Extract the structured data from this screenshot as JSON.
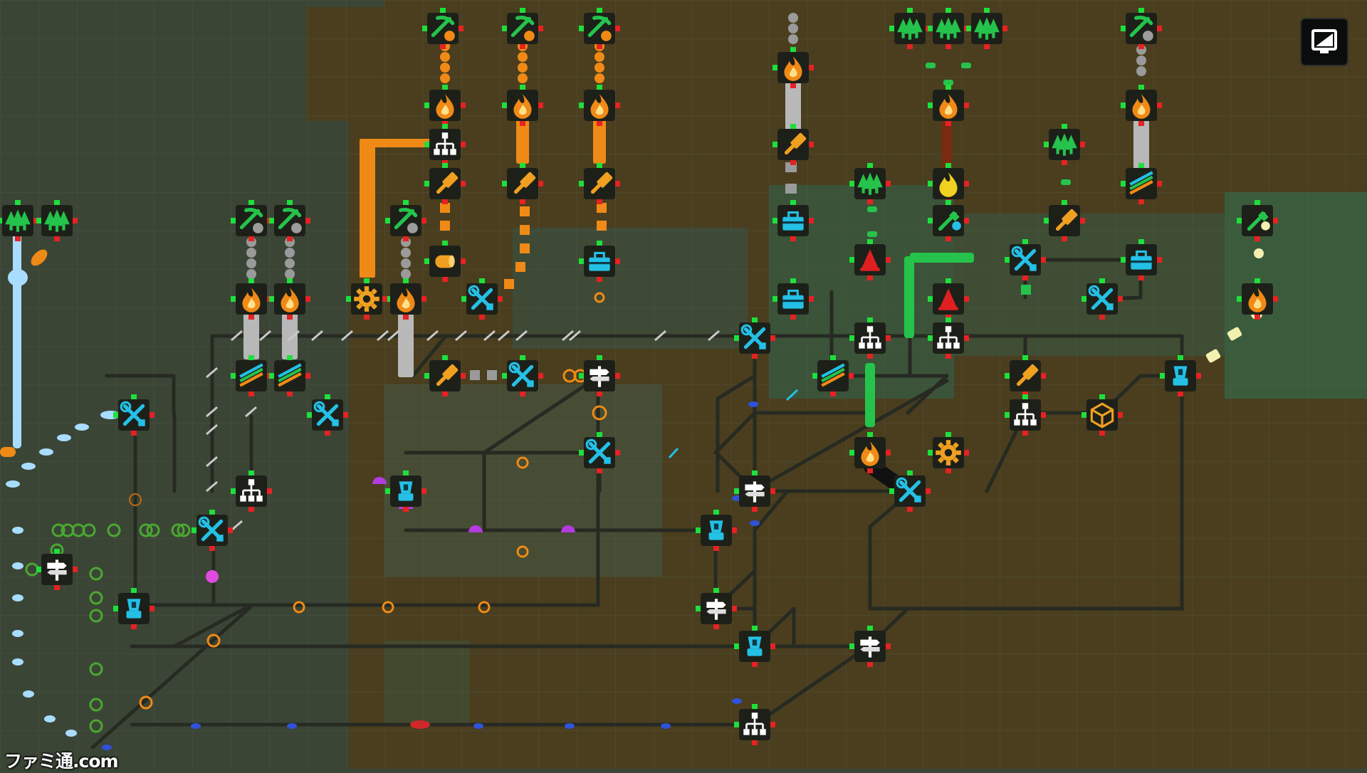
{
  "watermark": "ファミ通.com",
  "colors": {
    "ground_dark": "#3b4536",
    "ground_brown": "#4a3e1f",
    "ground_green": "#3e5a3e",
    "road": "#262a22",
    "tile_bg": "#1d2019",
    "ore_orange": "#f08a16",
    "stone_gray": "#9c9c9c",
    "wood_green": "#25c34b",
    "tool_cyan": "#24c0e6",
    "port_green": "#1de03c",
    "port_red": "#e62222",
    "gem_purple": "#b33be0",
    "light_blue": "#a8ddff"
  },
  "buildings": {
    "pickaxe_icon": [
      "mine-orange-1",
      "mine-orange-2",
      "mine-orange-3",
      "mine-stone-1",
      "mine-stone-2",
      "mine-stone-3",
      "mine-top-right",
      "mine-teal",
      "mine-right-edge"
    ],
    "furnace_icon": "smelter",
    "hammer_icon": "forge",
    "wrench_icon": "workshop",
    "hierarchy_icon": "splitter",
    "tree_icon": "lumber",
    "toolbox_icon": "packer",
    "blender_icon": "mixer",
    "gear_icon": "gear-press",
    "cube_icon": "assembler",
    "signpost_icon": "junction",
    "stripes_icon": "sorter"
  },
  "ui": {
    "toggle_view_icon": "screen-toggle-icon"
  }
}
